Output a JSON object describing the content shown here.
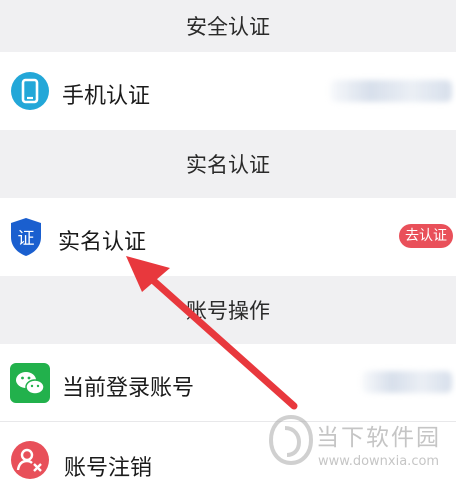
{
  "sections": {
    "security": {
      "header": "安全认证",
      "phone_label": "手机认证"
    },
    "realname": {
      "header": "实名认证",
      "item_label": "实名认证",
      "badge": "去认证"
    },
    "account": {
      "header": "账号操作",
      "current_label": "当前登录账号",
      "cancel_label": "账号注销"
    }
  },
  "watermark": {
    "name": "当下软件园",
    "url": "www.downxia.com"
  },
  "colors": {
    "badge": "#e9505a",
    "phone_icon": "#23a7d8",
    "shield_icon": "#1a5fcf",
    "wechat_icon": "#22b14c",
    "cancel_icon": "#e8505a",
    "arrow": "#e8383d"
  }
}
